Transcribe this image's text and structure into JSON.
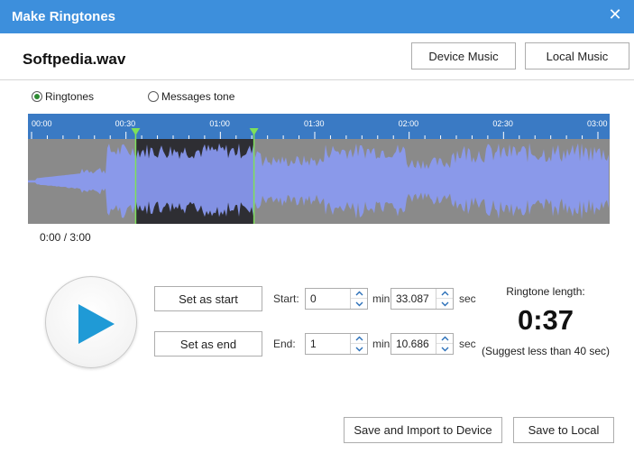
{
  "window": {
    "title": "Make Ringtones",
    "close_glyph": "✕"
  },
  "file": {
    "name": "Softpedia.wav"
  },
  "source_buttons": {
    "device_music": "Device Music",
    "local_music": "Local Music"
  },
  "mode": {
    "options": [
      {
        "label": "Ringtones",
        "checked": true
      },
      {
        "label": "Messages tone",
        "checked": false
      }
    ]
  },
  "timeline": {
    "ticks": [
      "00:00",
      "00:30",
      "01:00",
      "01:30",
      "02:00",
      "02:30",
      "03:00"
    ],
    "selection_start_sec": 33.087,
    "selection_end_sec": 70.686,
    "total_sec": 180
  },
  "playback": {
    "time_display": "0:00 / 3:00"
  },
  "controls": {
    "set_start_label": "Set as start",
    "set_end_label": "Set as end",
    "start": {
      "label": "Start:",
      "min": "0",
      "sec": "33.087"
    },
    "end": {
      "label": "End:",
      "min": "1",
      "sec": "10.686"
    },
    "min_unit": "min",
    "sec_unit": "sec"
  },
  "ringtone": {
    "length_label": "Ringtone length:",
    "length_value": "0:37",
    "hint": "(Suggest less than 40 sec)"
  },
  "footer": {
    "save_import": "Save and Import to Device",
    "save_local": "Save to Local"
  },
  "colors": {
    "titlebar": "#3d8fdc",
    "timeline_bar": "#3a7ac4",
    "wave_bg": "#8a8a8a",
    "wave_selected_bg": "#2e2e33",
    "wave_fill": "#8a9af2",
    "marker": "#7ee05a",
    "play_icon": "#1f9ad6"
  }
}
